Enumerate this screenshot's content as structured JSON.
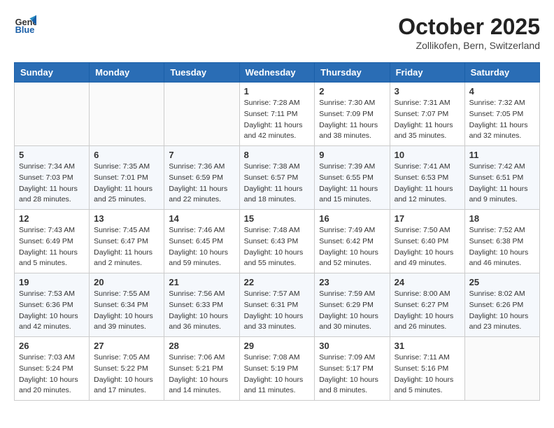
{
  "header": {
    "logo_general": "General",
    "logo_blue": "Blue",
    "month": "October 2025",
    "location": "Zollikofen, Bern, Switzerland"
  },
  "days_of_week": [
    "Sunday",
    "Monday",
    "Tuesday",
    "Wednesday",
    "Thursday",
    "Friday",
    "Saturday"
  ],
  "weeks": [
    [
      {
        "day": "",
        "info": ""
      },
      {
        "day": "",
        "info": ""
      },
      {
        "day": "",
        "info": ""
      },
      {
        "day": "1",
        "sunrise": "7:28 AM",
        "sunset": "7:11 PM",
        "daylight": "11 hours and 42 minutes."
      },
      {
        "day": "2",
        "sunrise": "7:30 AM",
        "sunset": "7:09 PM",
        "daylight": "11 hours and 38 minutes."
      },
      {
        "day": "3",
        "sunrise": "7:31 AM",
        "sunset": "7:07 PM",
        "daylight": "11 hours and 35 minutes."
      },
      {
        "day": "4",
        "sunrise": "7:32 AM",
        "sunset": "7:05 PM",
        "daylight": "11 hours and 32 minutes."
      }
    ],
    [
      {
        "day": "5",
        "sunrise": "7:34 AM",
        "sunset": "7:03 PM",
        "daylight": "11 hours and 28 minutes."
      },
      {
        "day": "6",
        "sunrise": "7:35 AM",
        "sunset": "7:01 PM",
        "daylight": "11 hours and 25 minutes."
      },
      {
        "day": "7",
        "sunrise": "7:36 AM",
        "sunset": "6:59 PM",
        "daylight": "11 hours and 22 minutes."
      },
      {
        "day": "8",
        "sunrise": "7:38 AM",
        "sunset": "6:57 PM",
        "daylight": "11 hours and 18 minutes."
      },
      {
        "day": "9",
        "sunrise": "7:39 AM",
        "sunset": "6:55 PM",
        "daylight": "11 hours and 15 minutes."
      },
      {
        "day": "10",
        "sunrise": "7:41 AM",
        "sunset": "6:53 PM",
        "daylight": "11 hours and 12 minutes."
      },
      {
        "day": "11",
        "sunrise": "7:42 AM",
        "sunset": "6:51 PM",
        "daylight": "11 hours and 9 minutes."
      }
    ],
    [
      {
        "day": "12",
        "sunrise": "7:43 AM",
        "sunset": "6:49 PM",
        "daylight": "11 hours and 5 minutes."
      },
      {
        "day": "13",
        "sunrise": "7:45 AM",
        "sunset": "6:47 PM",
        "daylight": "11 hours and 2 minutes."
      },
      {
        "day": "14",
        "sunrise": "7:46 AM",
        "sunset": "6:45 PM",
        "daylight": "10 hours and 59 minutes."
      },
      {
        "day": "15",
        "sunrise": "7:48 AM",
        "sunset": "6:43 PM",
        "daylight": "10 hours and 55 minutes."
      },
      {
        "day": "16",
        "sunrise": "7:49 AM",
        "sunset": "6:42 PM",
        "daylight": "10 hours and 52 minutes."
      },
      {
        "day": "17",
        "sunrise": "7:50 AM",
        "sunset": "6:40 PM",
        "daylight": "10 hours and 49 minutes."
      },
      {
        "day": "18",
        "sunrise": "7:52 AM",
        "sunset": "6:38 PM",
        "daylight": "10 hours and 46 minutes."
      }
    ],
    [
      {
        "day": "19",
        "sunrise": "7:53 AM",
        "sunset": "6:36 PM",
        "daylight": "10 hours and 42 minutes."
      },
      {
        "day": "20",
        "sunrise": "7:55 AM",
        "sunset": "6:34 PM",
        "daylight": "10 hours and 39 minutes."
      },
      {
        "day": "21",
        "sunrise": "7:56 AM",
        "sunset": "6:33 PM",
        "daylight": "10 hours and 36 minutes."
      },
      {
        "day": "22",
        "sunrise": "7:57 AM",
        "sunset": "6:31 PM",
        "daylight": "10 hours and 33 minutes."
      },
      {
        "day": "23",
        "sunrise": "7:59 AM",
        "sunset": "6:29 PM",
        "daylight": "10 hours and 30 minutes."
      },
      {
        "day": "24",
        "sunrise": "8:00 AM",
        "sunset": "6:27 PM",
        "daylight": "10 hours and 26 minutes."
      },
      {
        "day": "25",
        "sunrise": "8:02 AM",
        "sunset": "6:26 PM",
        "daylight": "10 hours and 23 minutes."
      }
    ],
    [
      {
        "day": "26",
        "sunrise": "7:03 AM",
        "sunset": "5:24 PM",
        "daylight": "10 hours and 20 minutes."
      },
      {
        "day": "27",
        "sunrise": "7:05 AM",
        "sunset": "5:22 PM",
        "daylight": "10 hours and 17 minutes."
      },
      {
        "day": "28",
        "sunrise": "7:06 AM",
        "sunset": "5:21 PM",
        "daylight": "10 hours and 14 minutes."
      },
      {
        "day": "29",
        "sunrise": "7:08 AM",
        "sunset": "5:19 PM",
        "daylight": "10 hours and 11 minutes."
      },
      {
        "day": "30",
        "sunrise": "7:09 AM",
        "sunset": "5:17 PM",
        "daylight": "10 hours and 8 minutes."
      },
      {
        "day": "31",
        "sunrise": "7:11 AM",
        "sunset": "5:16 PM",
        "daylight": "10 hours and 5 minutes."
      },
      {
        "day": "",
        "info": ""
      }
    ]
  ],
  "labels": {
    "sunrise": "Sunrise:",
    "sunset": "Sunset:",
    "daylight": "Daylight hours"
  }
}
